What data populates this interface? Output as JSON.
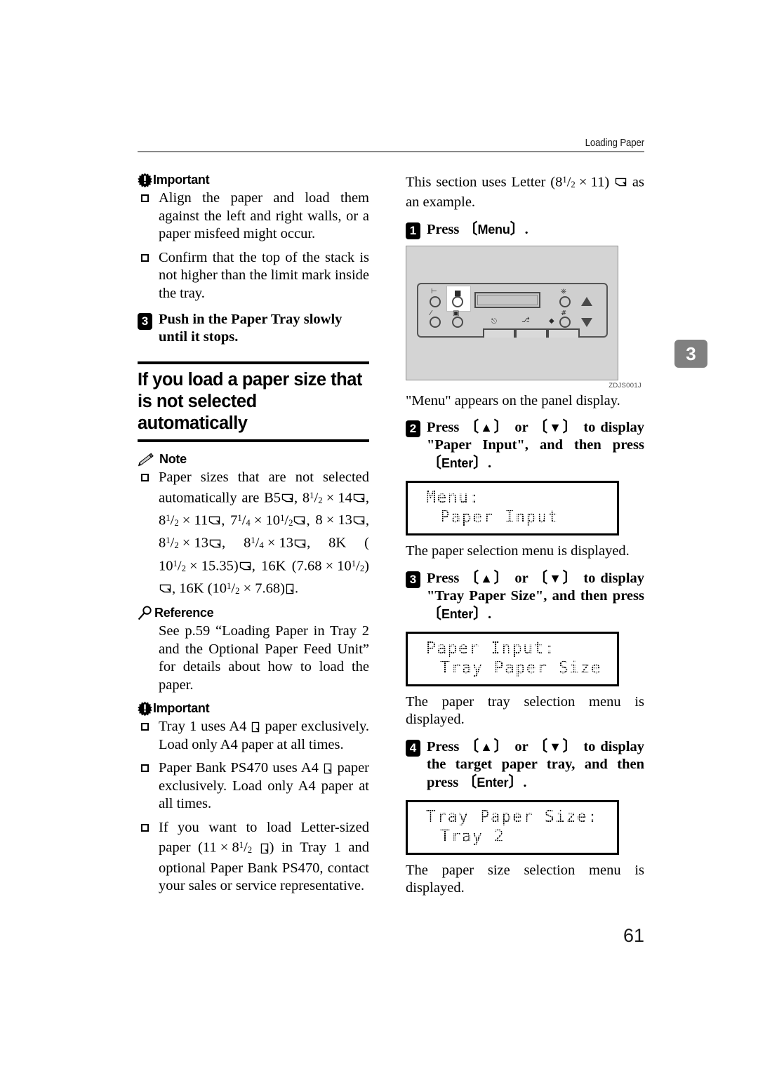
{
  "header": {
    "running_head": "Loading Paper"
  },
  "chapter_tab": "3",
  "folio": "61",
  "left_column": {
    "important_1": {
      "label": "Important",
      "icon": "important-starburst-icon",
      "items": [
        "Align the paper and load them against the left and right walls, or a paper misfeed might occur.",
        "Confirm that the top of the stack is not higher than the limit mark inside the tray."
      ]
    },
    "step_3": {
      "number": "3",
      "text": "Push in the Paper Tray slowly until it stops."
    },
    "section_heading": "If you load a paper size that is not selected automatically",
    "note": {
      "label": "Note",
      "icon": "pencil-icon",
      "item_prefix": "Paper sizes that are not selected automatically are B5",
      "item_full": "Paper sizes that are not selected automatically are B5⬜, 8 1/2 × 14⬜, 8 1/2 × 11⬜, 7 1/4 × 10 1/2⬜, 8 × 13⬜, 8 1/2 × 13⬜, 8 1/4 × 13⬜, 8K (10 1/2 × 15.35)⬜, 16K (7.68 × 10 1/2)⬜, 16K (10 1/2 × 7.68)⬜."
    },
    "reference": {
      "label": "Reference",
      "icon": "magnifier-icon",
      "text": "See p.59 “Loading Paper in Tray 2 and the Optional Paper Feed Unit” for details about how to load the paper."
    },
    "important_2": {
      "label": "Important",
      "icon": "important-starburst-icon",
      "items": [
        "Tray 1 uses A4 ◯ paper exclusively. Load only A4 paper at all times.",
        "Paper Bank PS470 uses A4 ◯ paper exclusively. Load only A4 paper at all times.",
        "If you want to load Letter-sized paper (11 × 8 1/2 ◯) in Tray 1 and optional Paper Bank PS470, contact your sales or service representative."
      ]
    }
  },
  "right_column": {
    "intro": "This section uses Letter (8 1/2 × 11) ⬜ as an example.",
    "step_1": {
      "number": "1",
      "text_pre": "Press ",
      "key": "Menu",
      "text_post": "."
    },
    "illustration": {
      "caption": "ZDJS001J",
      "name": "printer-control-panel"
    },
    "after_1": "\"Menu\" appears on the panel display.",
    "step_2": {
      "number": "2",
      "text_a": "Press ",
      "key_up": "▲",
      "text_b": " or ",
      "key_down": "▼",
      "text_c": " to display \"Paper Input\", and then press ",
      "key_enter": "Enter",
      "text_d": "."
    },
    "lcd_1": {
      "line1": "Menu:",
      "line2": "Paper Input"
    },
    "after_2": "The paper selection menu is displayed.",
    "step_3": {
      "number": "3",
      "text_a": "Press ",
      "key_up": "▲",
      "text_b": " or ",
      "key_down": "▼",
      "text_c": " to display \"Tray Paper Size\", and then press ",
      "key_enter": "Enter",
      "text_d": "."
    },
    "lcd_2": {
      "line1": "Paper Input:",
      "line2": "Tray Paper Size"
    },
    "after_3": "The paper tray selection menu is displayed.",
    "step_4": {
      "number": "4",
      "text_a": "Press ",
      "key_up": "▲",
      "text_b": " or ",
      "key_down": "▼",
      "text_c": " to display the target paper tray, and then press ",
      "key_enter": "Enter",
      "text_d": "."
    },
    "lcd_3": {
      "line1": "Tray Paper Size:",
      "line2": "Tray 2"
    },
    "after_4": "The paper size selection menu is displayed."
  },
  "colors": {
    "header_rule": "#8a8a8a",
    "chapter_tab_bg": "#808080",
    "illustration_bg": "#d4d4d4",
    "panel_bg": "#cfcfcf"
  }
}
